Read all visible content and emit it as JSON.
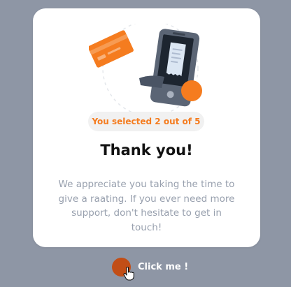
{
  "card": {
    "selection_badge": "You selected 2 out of 5",
    "title": "Thank you!",
    "message": "We appreciate you taking the time to give a raating. If you ever need more support, don't hesitate to get in touch!"
  },
  "cta": {
    "label": "Click me !"
  },
  "rating": {
    "selected": 2,
    "max": 5
  },
  "colors": {
    "background": "#8e96a5",
    "card": "#ffffff",
    "accent": "#f57c1f",
    "badge_bg": "#f1f1f1",
    "title": "#111111",
    "muted_text": "#98a0ae",
    "cta_dot": "#c24e16"
  },
  "icons": {
    "illustration": "phone-receipt-card-illustration",
    "cursor": "hand-pointer-cursor-icon"
  }
}
